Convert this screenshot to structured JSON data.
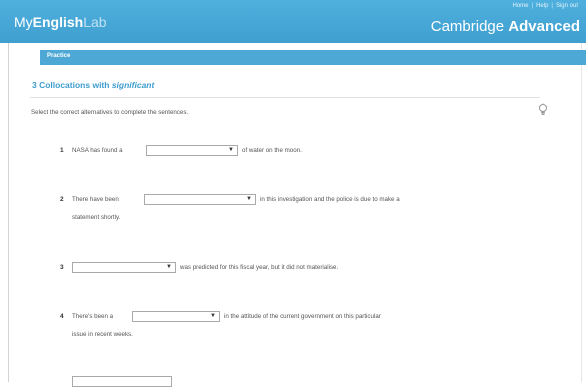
{
  "header": {
    "logo_prefix": "My",
    "logo_main": "English",
    "logo_suffix": "Lab",
    "links": [
      "Home",
      "Help",
      "Sign out"
    ],
    "brand_light": "Cambridge",
    "brand_bold": "Advanced"
  },
  "tab": {
    "label": "Practice"
  },
  "exercise": {
    "title_prefix": "3 Collocations with",
    "title_keyword": "significant",
    "instruction": "Select the correct alternatives to complete the sentences.",
    "hint_icon": "lightbulb-icon",
    "questions": [
      {
        "number": "1",
        "before": "NASA has found a",
        "after": "of water on the moon.",
        "continuation": ""
      },
      {
        "number": "2",
        "before": "There have been",
        "after": "in this investigation and the police is due to make a",
        "continuation": "statement shortly."
      },
      {
        "number": "3",
        "before": "",
        "after": "was predicted for this fiscal year, but it did not materialise.",
        "continuation": ""
      },
      {
        "number": "4",
        "before": "There's been a",
        "after": "in the attitude of the current government on this particular",
        "continuation": "issue in recent weeks."
      }
    ]
  },
  "colors": {
    "header_blue": "#4fb0de",
    "tab_blue": "#4ea8d6",
    "title_blue": "#3d9ccd"
  }
}
